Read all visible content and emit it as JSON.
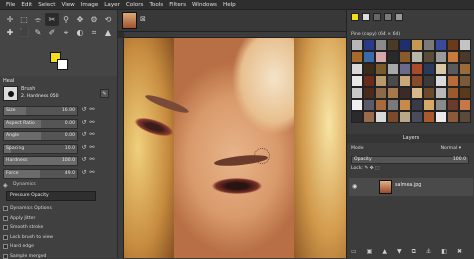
{
  "menubar": [
    "File",
    "Edit",
    "Select",
    "View",
    "Image",
    "Layer",
    "Colors",
    "Tools",
    "Filters",
    "Windows",
    "Help"
  ],
  "tools": [
    "✛",
    "⬚",
    "⌯",
    "✂",
    "⚲",
    "✥",
    "⚙",
    "⟲",
    "✚",
    "⬛",
    "✎",
    "✐",
    "⌖",
    "◐",
    "⌗",
    "▲"
  ],
  "colors": {
    "foreground": "#f3de19",
    "background": "#ffffff"
  },
  "tool_options": {
    "title": "Heal",
    "brush_label": "Brush",
    "brush_name": "2. Hardness 050",
    "sliders": [
      {
        "label": "Size",
        "value": "16.00",
        "fraction": 0.3
      },
      {
        "label": "Aspect Ratio",
        "value": "0.00",
        "fraction": 0.5
      },
      {
        "label": "Angle",
        "value": "0.00",
        "fraction": 0.5
      },
      {
        "label": "Spacing",
        "value": "10.0",
        "fraction": 0.1
      },
      {
        "label": "Hardness",
        "value": "100.0",
        "fraction": 1.0
      },
      {
        "label": "Force",
        "value": "49.0",
        "fraction": 0.49
      }
    ],
    "dynamics_label": "Dynamics",
    "dynamics_value": "Pressure Opacity",
    "checkboxes": [
      "Dynamics Options",
      "Apply Jitter",
      "Smooth stroke",
      "Lock brush to view",
      "Hard edge",
      "Sample merged"
    ]
  },
  "dock": {
    "pattern_title": "Pine (copy) (64 × 64)",
    "layers_title": "Layers",
    "mode_label": "Mode",
    "mode_value": "Normal ▾",
    "opacity_label": "Opacity",
    "opacity_value": "100.0",
    "lock_label": "Lock:",
    "layer_name": "salmea.jpg"
  }
}
